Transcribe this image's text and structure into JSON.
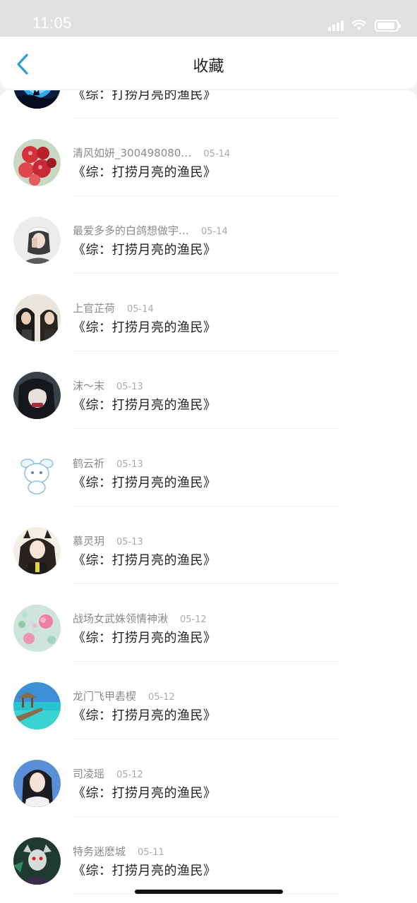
{
  "status_bar": {
    "time": "11:05"
  },
  "nav": {
    "title": "收藏"
  },
  "items": [
    {
      "author": "",
      "date": "",
      "title": "《综：打捞月亮的渔民》",
      "avatar": "moon-night-avatar"
    },
    {
      "author": "清风如妍_300498080…",
      "date": "05-14",
      "title": "《综：打捞月亮的渔民》",
      "avatar": "red-berries-avatar"
    },
    {
      "author": "最爱多多的白鸽想做宇…",
      "date": "05-14",
      "title": "《综：打捞月亮的渔民》",
      "avatar": "girl-selfie-avatar"
    },
    {
      "author": "上官芷荷",
      "date": "05-14",
      "title": "《综：打捞月亮的渔民》",
      "avatar": "two-people-avatar"
    },
    {
      "author": "沫～末",
      "date": "05-13",
      "title": "《综：打捞月亮的渔民》",
      "avatar": "dark-girl-avatar"
    },
    {
      "author": "鹤云祈",
      "date": "05-13",
      "title": "《综：打捞月亮的渔民》",
      "avatar": "cartoon-bunny-avatar"
    },
    {
      "author": "慕灵玥",
      "date": "05-13",
      "title": "《综：打捞月亮的渔民》",
      "avatar": "anime-girl-avatar"
    },
    {
      "author": "战场女武姝领情神湫",
      "date": "05-12",
      "title": "《综：打捞月亮的渔民》",
      "avatar": "pink-flowers-avatar"
    },
    {
      "author": "龙门飞甲砉楔",
      "date": "05-12",
      "title": "《综：打捞月亮的渔民》",
      "avatar": "beach-pier-avatar"
    },
    {
      "author": "司凌瑶",
      "date": "05-12",
      "title": "《综：打捞月亮的渔民》",
      "avatar": "woman-portrait-avatar"
    },
    {
      "author": "特务迷麽城",
      "date": "05-11",
      "title": "《综：打捞月亮的渔民》",
      "avatar": "game-character-avatar"
    }
  ]
}
